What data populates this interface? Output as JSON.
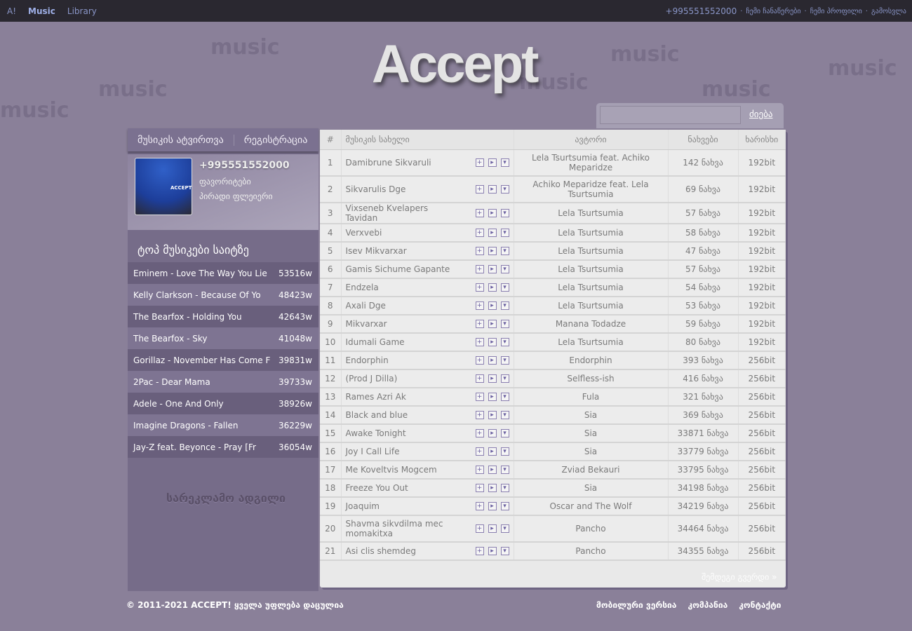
{
  "topbar": {
    "left": [
      "A!",
      "Music",
      "Library"
    ],
    "phone": "+995551552000",
    "links": [
      "ჩემი ჩანაწერები",
      "ჩემი პროფილი",
      "გამოსვლა"
    ]
  },
  "logo": "Accept",
  "search": {
    "button": "ძიება",
    "value": ""
  },
  "auth": {
    "login": "მუსიკის ატვირთვა",
    "register": "რეგისტრაცია"
  },
  "profile": {
    "phone": "+995551552000",
    "favorites": "ფავორიტები",
    "player": "პირადი ფლეიერი",
    "avatar_text": "ACCEPT"
  },
  "top": {
    "title": "ტოპ მუსიკები საიტზე",
    "items": [
      {
        "t": "Eminem - Love The Way You Lie",
        "c": "53516w"
      },
      {
        "t": "Kelly Clarkson - Because Of Yo",
        "c": "48423w"
      },
      {
        "t": "The Bearfox - Holding You",
        "c": "42643w"
      },
      {
        "t": "The Bearfox - Sky",
        "c": "41048w"
      },
      {
        "t": "Gorillaz - November Has Come F",
        "c": "39831w"
      },
      {
        "t": "2Pac - Dear Mama",
        "c": "39733w"
      },
      {
        "t": "Adele - One And Only",
        "c": "38926w"
      },
      {
        "t": "Imagine Dragons - Fallen",
        "c": "36229w"
      },
      {
        "t": "Jay-Z feat. Beyonce - Pray [Fr",
        "c": "36054w"
      }
    ]
  },
  "ad": "სარეკლამო ადგილი",
  "table": {
    "headers": [
      "#",
      "მუსიკის სახელი",
      "ავტორი",
      "ნახვები",
      "ხარისხი"
    ],
    "rows": [
      [
        "1",
        "Damibrune Sikvaruli",
        "Lela Tsurtsumia feat. Achiko Meparidze",
        "142 ნახვა",
        "192bit"
      ],
      [
        "2",
        "Sikvarulis Dge",
        "Achiko Meparidze feat. Lela Tsurtsumia",
        "69 ნახვა",
        "192bit"
      ],
      [
        "3",
        "Vixseneb Kvelapers Tavidan",
        "Lela Tsurtsumia",
        "57 ნახვა",
        "192bit"
      ],
      [
        "4",
        "Verxvebi",
        "Lela Tsurtsumia",
        "58 ნახვა",
        "192bit"
      ],
      [
        "5",
        "Isev Mikvarxar",
        "Lela Tsurtsumia",
        "47 ნახვა",
        "192bit"
      ],
      [
        "6",
        "Gamis Sichume Gapante",
        "Lela Tsurtsumia",
        "57 ნახვა",
        "192bit"
      ],
      [
        "7",
        "Endzela",
        "Lela Tsurtsumia",
        "54 ნახვა",
        "192bit"
      ],
      [
        "8",
        "Axali Dge",
        "Lela Tsurtsumia",
        "53 ნახვა",
        "192bit"
      ],
      [
        "9",
        "Mikvarxar",
        "Manana Todadze",
        "59 ნახვა",
        "192bit"
      ],
      [
        "10",
        "Idumali Game",
        "Lela Tsurtsumia",
        "80 ნახვა",
        "192bit"
      ],
      [
        "11",
        "Endorphin",
        "Endorphin",
        "393 ნახვა",
        "256bit"
      ],
      [
        "12",
        "(Prod J Dilla)",
        "Selfless-ish",
        "416 ნახვა",
        "256bit"
      ],
      [
        "13",
        "Rames Azri Ak",
        "Fula",
        "321 ნახვა",
        "256bit"
      ],
      [
        "14",
        "Black and blue",
        "Sia",
        "369 ნახვა",
        "256bit"
      ],
      [
        "15",
        "Awake Tonight",
        "Sia",
        "33871 ნახვა",
        "256bit"
      ],
      [
        "16",
        "Joy I Call Life",
        "Sia",
        "33779 ნახვა",
        "256bit"
      ],
      [
        "17",
        "Me Koveltvis Mogcem",
        "Zviad Bekauri",
        "33795 ნახვა",
        "256bit"
      ],
      [
        "18",
        "Freeze You Out",
        "Sia",
        "34198 ნახვა",
        "256bit"
      ],
      [
        "19",
        "Joaquim",
        "Oscar and The Wolf",
        "34219 ნახვა",
        "256bit"
      ],
      [
        "20",
        "Shavma sikvdilma mec momakitxa",
        "Pancho",
        "34464 ნახვა",
        "256bit"
      ],
      [
        "21",
        "Asi clis shemdeg",
        "Pancho",
        "34355 ნახვა",
        "256bit"
      ]
    ]
  },
  "next_page": "შემდეგი გვერდი »",
  "footer": {
    "copyright": "© 2011-2021 ACCEPT! ყველა უფლება დაცულია",
    "links": [
      "მობილური ვერსია",
      "კომპანია",
      "კონტაქტი"
    ]
  }
}
